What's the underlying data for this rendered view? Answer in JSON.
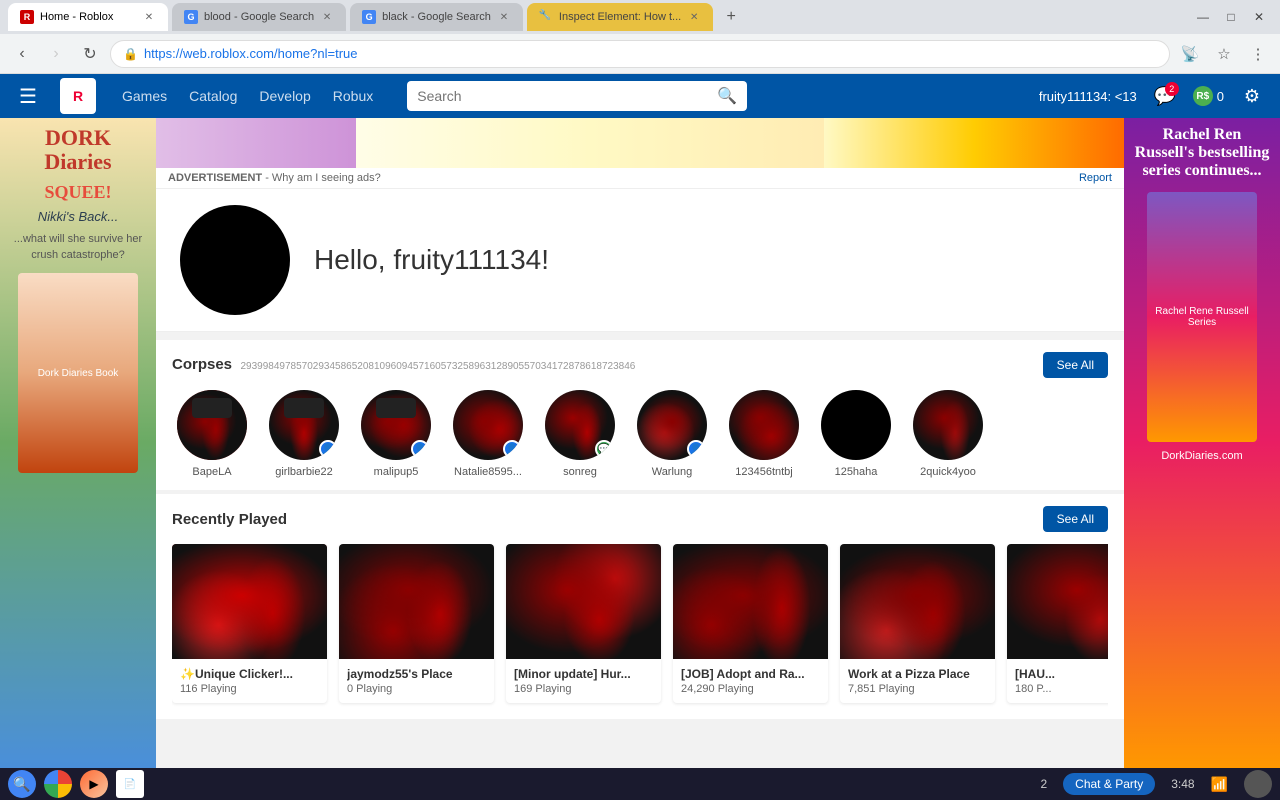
{
  "browser": {
    "tabs": [
      {
        "id": "roblox",
        "label": "Home - Roblox",
        "favicon": "🟥",
        "active": true,
        "url": "https://web.roblox.com/home?nl=true"
      },
      {
        "id": "blood-search",
        "label": "blood - Google Search",
        "favicon": "🔵",
        "active": false
      },
      {
        "id": "black-search",
        "label": "black - Google Search",
        "favicon": "🔵",
        "active": false
      },
      {
        "id": "inspect",
        "label": "Inspect Element: How t...",
        "favicon": "🔧",
        "active": false
      }
    ],
    "url": "https://web.roblox.com/home?nl=true",
    "new_tab_label": "+",
    "window_controls": [
      "—",
      "□",
      "✕"
    ]
  },
  "roblox_header": {
    "hamburger": "☰",
    "logo": "R",
    "nav": [
      "Games",
      "Catalog",
      "Develop",
      "Robux"
    ],
    "search_placeholder": "Search",
    "username": "fruity111134: <13",
    "chat_icon": "💬",
    "chat_badge": "2",
    "robux_icon": "R$",
    "robux_count": "0",
    "settings_icon": "⚙"
  },
  "ad_banner": {
    "label": "ADVERTISEMENT",
    "why_text": "- Why am I seeing ads?",
    "report": "Report"
  },
  "profile": {
    "greeting": "Hello, fruity111134!"
  },
  "corpses_section": {
    "title": "Corpses",
    "subtitle": "29399849785702934586520810960945716057325896312890557034172878618723846",
    "see_all": "See All",
    "friends": [
      {
        "name": "BapeLA",
        "online": false,
        "black": false
      },
      {
        "name": "girlbarbie22",
        "online": true,
        "black": false
      },
      {
        "name": "malipup5",
        "online": true,
        "black": false
      },
      {
        "name": "Natalie8595...",
        "online": true,
        "black": false
      },
      {
        "name": "sonreg",
        "online": false,
        "black": false
      },
      {
        "name": "Warlung",
        "online": true,
        "black": false
      },
      {
        "name": "123456tntbj",
        "online": false,
        "black": false
      },
      {
        "name": "125haha",
        "online": false,
        "black": true
      },
      {
        "name": "2quick4yoo",
        "online": false,
        "black": false
      }
    ]
  },
  "recently_played": {
    "title": "Recently Played",
    "see_all": "See All",
    "games": [
      {
        "title": "✨Unique Clicker!...",
        "playing": "116 Playing",
        "special": true
      },
      {
        "title": "jaymodz55's Place",
        "playing": "0 Playing",
        "special": false
      },
      {
        "title": "[Minor update] Hur...",
        "playing": "169 Playing",
        "special": false
      },
      {
        "title": "[JOB] Adopt and Ra...",
        "playing": "24,290 Playing",
        "special": false
      },
      {
        "title": "Work at a Pizza Place",
        "playing": "7,851 Playing",
        "special": false
      },
      {
        "title": "[HAU...",
        "playing": "180 P...",
        "special": false
      }
    ]
  },
  "left_ad": {
    "title": "DORK\nDiaries",
    "line1": "SQUEE!",
    "line2": "Nikki's Back...",
    "line3": "...what will she survive her crush catastrophe?"
  },
  "right_ad": {
    "line1": "Rachel Ren Russell's bestselling series continues...",
    "line2": "DorkDiaries.com"
  },
  "taskbar": {
    "time": "3:48",
    "notification_count": "2",
    "chat_party": "Chat & Party"
  }
}
